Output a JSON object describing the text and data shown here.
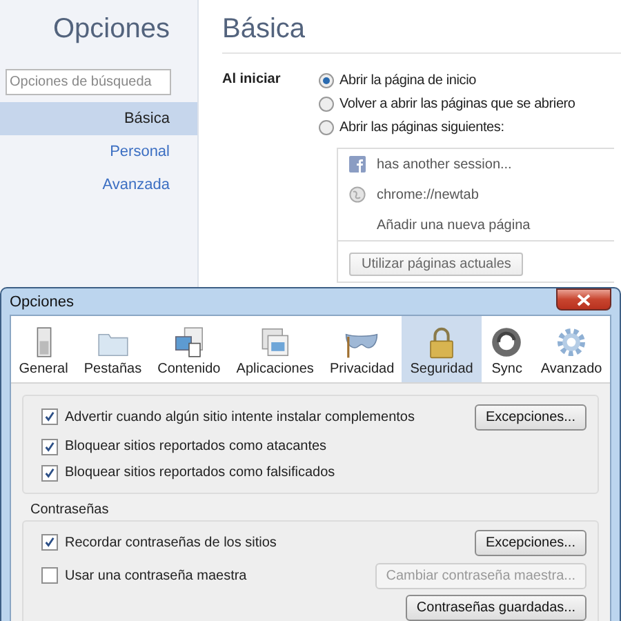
{
  "settings_page": {
    "sidebar": {
      "title": "Opciones",
      "search": {
        "placeholder": "Opciones de búsqueda"
      },
      "items": [
        {
          "label": "Básica",
          "selected": true
        },
        {
          "label": "Personal",
          "selected": false
        },
        {
          "label": "Avanzada",
          "selected": false
        }
      ]
    },
    "section_title": "Básica",
    "startup": {
      "label": "Al iniciar",
      "options": [
        {
          "label": "Abrir la página de inicio",
          "selected": true
        },
        {
          "label": "Volver a abrir las páginas que se abriero",
          "selected": false
        },
        {
          "label": "Abrir las páginas siguientes:",
          "selected": false
        }
      ],
      "pages": [
        {
          "kind": "facebook",
          "label": "has another session..."
        },
        {
          "kind": "globe",
          "label": "chrome://newtab"
        },
        {
          "kind": "add",
          "label": "Añadir una nueva página"
        }
      ],
      "use_current_button": "Utilizar páginas actuales"
    }
  },
  "dialog": {
    "title": "Opciones",
    "tabs": [
      {
        "kind": "general",
        "label": "General",
        "selected": false
      },
      {
        "kind": "tabs",
        "label": "Pestañas",
        "selected": false
      },
      {
        "kind": "content",
        "label": "Contenido",
        "selected": false
      },
      {
        "kind": "apps",
        "label": "Aplicaciones",
        "selected": false
      },
      {
        "kind": "privacy",
        "label": "Privacidad",
        "selected": false
      },
      {
        "kind": "security",
        "label": "Seguridad",
        "selected": true
      },
      {
        "kind": "sync",
        "label": "Sync",
        "selected": false
      },
      {
        "kind": "advanced",
        "label": "Avanzado",
        "selected": false
      }
    ],
    "groups": [
      {
        "rows": [
          {
            "label": "Advertir cuando algún sitio intente instalar complementos",
            "checked": true,
            "button": {
              "label": "Excepciones...",
              "disabled": false
            }
          },
          {
            "label": "Bloquear sitios reportados como atacantes",
            "checked": true
          },
          {
            "label": "Bloquear sitios reportados como falsificados",
            "checked": true
          }
        ]
      },
      {
        "title": "Contraseñas",
        "rows": [
          {
            "label": "Recordar contraseñas de los sitios",
            "checked": true,
            "button": {
              "label": "Excepciones...",
              "disabled": false
            }
          },
          {
            "label": "Usar una contraseña maestra",
            "checked": false,
            "button": {
              "label": "Cambiar contraseña maestra...",
              "disabled": true
            }
          }
        ],
        "footer_button": {
          "label": "Contraseñas guardadas...",
          "disabled": false
        }
      }
    ]
  }
}
